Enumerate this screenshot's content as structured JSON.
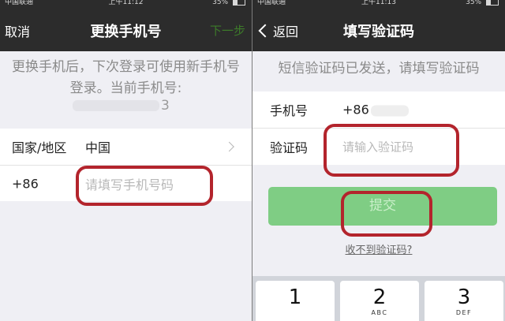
{
  "left": {
    "status": {
      "carrier": "中国联通",
      "time": "上午11:12",
      "battery": "35%"
    },
    "nav": {
      "cancel": "取消",
      "title": "更换手机号",
      "next": "下一步"
    },
    "notice": "更换手机后，下次登录可使用新手机号登录。当前手机号:",
    "masked_tail": "3",
    "country_row": {
      "label": "国家/地区",
      "value": "中国"
    },
    "phone_row": {
      "label": "+86",
      "placeholder": "请填写手机号码"
    }
  },
  "right": {
    "status": {
      "carrier": "中国联通",
      "time": "上午11:13",
      "battery": "35%"
    },
    "nav": {
      "back": "返回",
      "title": "填写验证码"
    },
    "subtitle": "短信验证码已发送，请填写验证码",
    "phone_row": {
      "label": "手机号",
      "value": "+86"
    },
    "code_row": {
      "label": "验证码",
      "placeholder": "请输入验证码"
    },
    "submit": "提交",
    "help": "收不到验证码?",
    "keys": [
      {
        "num": "1",
        "letters": ""
      },
      {
        "num": "2",
        "letters": "ABC"
      },
      {
        "num": "3",
        "letters": "DEF"
      }
    ]
  },
  "colors": {
    "nav_bg": "#2c2c2c",
    "accent_green": "#7fcd84",
    "annotation_red": "#b3242c"
  },
  "icons": [
    "wifi-icon",
    "battery-icon",
    "chevron-right-icon",
    "back-chevron-icon"
  ]
}
